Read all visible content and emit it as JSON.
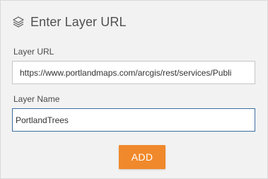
{
  "dialog": {
    "title": "Enter Layer URL",
    "icon": "layers-icon"
  },
  "form": {
    "url_label": "Layer URL",
    "url_value": "https://www.portlandmaps.com/arcgis/rest/services/Publi",
    "name_label": "Layer Name",
    "name_value": "PortlandTrees",
    "add_label": "ADD"
  },
  "colors": {
    "panel_bg": "#f2f2f2",
    "button_bg": "#f0892b",
    "focus_border": "#3c6ea3"
  }
}
